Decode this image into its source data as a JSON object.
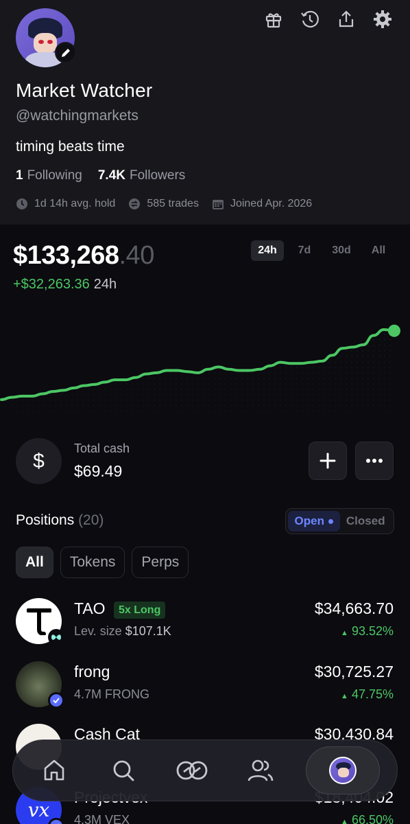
{
  "profile": {
    "name": "Market Watcher",
    "handle": "@watchingmarkets",
    "bio": "timing beats time",
    "following_count": "1",
    "following_label": "Following",
    "followers_count": "7.4K",
    "followers_label": "Followers",
    "avg_hold": "1d 14h avg. hold",
    "trades": "585 trades",
    "joined": "Joined Apr. 2026"
  },
  "header_icons": [
    "gift-icon",
    "history-icon",
    "share-icon",
    "settings-icon"
  ],
  "portfolio": {
    "balance_main": "$133,268",
    "balance_cents": ".40",
    "change_value": "+$32,263.36",
    "change_period": "24h",
    "timeframes": [
      "24h",
      "7d",
      "30d",
      "All"
    ],
    "active_timeframe": "24h"
  },
  "chart_data": {
    "type": "line",
    "title": "",
    "xlabel": "",
    "ylabel": "",
    "y": [
      0,
      2,
      3,
      3,
      5,
      7,
      8,
      10,
      12,
      13,
      15,
      17,
      17,
      19,
      22,
      23,
      25,
      25,
      24,
      23,
      26,
      28,
      26,
      25,
      25,
      26,
      29,
      32,
      31,
      31,
      32,
      33,
      38,
      44,
      45,
      47,
      55,
      60,
      59
    ],
    "color": "#4cc764"
  },
  "cash": {
    "label": "Total cash",
    "value": "$69.49"
  },
  "positions": {
    "title": "Positions",
    "count": "(20)",
    "toggle_open": "Open",
    "toggle_closed": "Closed",
    "filters": [
      "All",
      "Tokens",
      "Perps"
    ],
    "items": [
      {
        "name": "TAO",
        "badge": "5x Long",
        "sub_label": "Lev. size",
        "sub_value": "$107.1K",
        "value": "$34,663.70",
        "pct": "93.52%"
      },
      {
        "name": "frong",
        "sub_label": "4.7M FRONG",
        "value": "$30,725.27",
        "pct": "47.75%"
      },
      {
        "name": "Cash Cat",
        "sub_label": "",
        "value": "$30,430.84",
        "pct": ""
      },
      {
        "name": "Projectvex",
        "sub_label": "4.3M VEX",
        "value": "$18,404.02",
        "pct": "66.50%"
      }
    ]
  },
  "nav": [
    "home-icon",
    "search-icon",
    "trade-icon",
    "people-icon",
    "profile-avatar"
  ],
  "colors": {
    "positive": "#4cc764",
    "accent": "#6d86ff",
    "background": "#0b0b10"
  }
}
